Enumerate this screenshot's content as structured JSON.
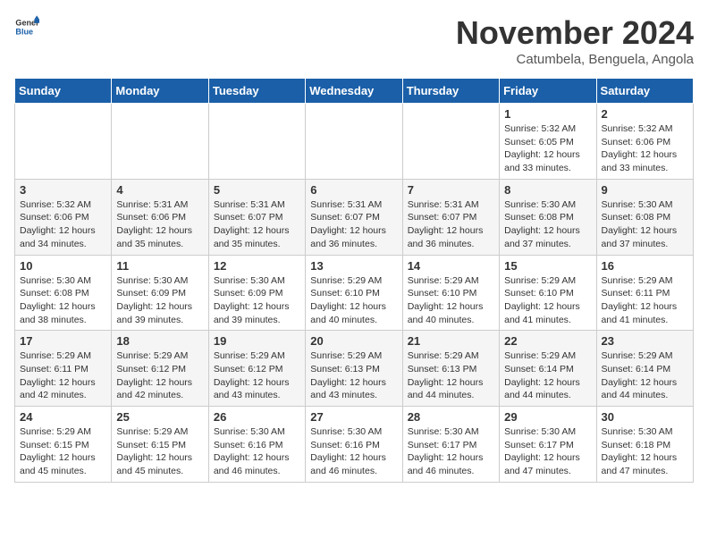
{
  "header": {
    "logo_general": "General",
    "logo_blue": "Blue",
    "month_title": "November 2024",
    "subtitle": "Catumbela, Benguela, Angola"
  },
  "weekdays": [
    "Sunday",
    "Monday",
    "Tuesday",
    "Wednesday",
    "Thursday",
    "Friday",
    "Saturday"
  ],
  "weeks": [
    [
      {
        "day": "",
        "info": ""
      },
      {
        "day": "",
        "info": ""
      },
      {
        "day": "",
        "info": ""
      },
      {
        "day": "",
        "info": ""
      },
      {
        "day": "",
        "info": ""
      },
      {
        "day": "1",
        "info": "Sunrise: 5:32 AM\nSunset: 6:05 PM\nDaylight: 12 hours\nand 33 minutes."
      },
      {
        "day": "2",
        "info": "Sunrise: 5:32 AM\nSunset: 6:06 PM\nDaylight: 12 hours\nand 33 minutes."
      }
    ],
    [
      {
        "day": "3",
        "info": "Sunrise: 5:32 AM\nSunset: 6:06 PM\nDaylight: 12 hours\nand 34 minutes."
      },
      {
        "day": "4",
        "info": "Sunrise: 5:31 AM\nSunset: 6:06 PM\nDaylight: 12 hours\nand 35 minutes."
      },
      {
        "day": "5",
        "info": "Sunrise: 5:31 AM\nSunset: 6:07 PM\nDaylight: 12 hours\nand 35 minutes."
      },
      {
        "day": "6",
        "info": "Sunrise: 5:31 AM\nSunset: 6:07 PM\nDaylight: 12 hours\nand 36 minutes."
      },
      {
        "day": "7",
        "info": "Sunrise: 5:31 AM\nSunset: 6:07 PM\nDaylight: 12 hours\nand 36 minutes."
      },
      {
        "day": "8",
        "info": "Sunrise: 5:30 AM\nSunset: 6:08 PM\nDaylight: 12 hours\nand 37 minutes."
      },
      {
        "day": "9",
        "info": "Sunrise: 5:30 AM\nSunset: 6:08 PM\nDaylight: 12 hours\nand 37 minutes."
      }
    ],
    [
      {
        "day": "10",
        "info": "Sunrise: 5:30 AM\nSunset: 6:08 PM\nDaylight: 12 hours\nand 38 minutes."
      },
      {
        "day": "11",
        "info": "Sunrise: 5:30 AM\nSunset: 6:09 PM\nDaylight: 12 hours\nand 39 minutes."
      },
      {
        "day": "12",
        "info": "Sunrise: 5:30 AM\nSunset: 6:09 PM\nDaylight: 12 hours\nand 39 minutes."
      },
      {
        "day": "13",
        "info": "Sunrise: 5:29 AM\nSunset: 6:10 PM\nDaylight: 12 hours\nand 40 minutes."
      },
      {
        "day": "14",
        "info": "Sunrise: 5:29 AM\nSunset: 6:10 PM\nDaylight: 12 hours\nand 40 minutes."
      },
      {
        "day": "15",
        "info": "Sunrise: 5:29 AM\nSunset: 6:10 PM\nDaylight: 12 hours\nand 41 minutes."
      },
      {
        "day": "16",
        "info": "Sunrise: 5:29 AM\nSunset: 6:11 PM\nDaylight: 12 hours\nand 41 minutes."
      }
    ],
    [
      {
        "day": "17",
        "info": "Sunrise: 5:29 AM\nSunset: 6:11 PM\nDaylight: 12 hours\nand 42 minutes."
      },
      {
        "day": "18",
        "info": "Sunrise: 5:29 AM\nSunset: 6:12 PM\nDaylight: 12 hours\nand 42 minutes."
      },
      {
        "day": "19",
        "info": "Sunrise: 5:29 AM\nSunset: 6:12 PM\nDaylight: 12 hours\nand 43 minutes."
      },
      {
        "day": "20",
        "info": "Sunrise: 5:29 AM\nSunset: 6:13 PM\nDaylight: 12 hours\nand 43 minutes."
      },
      {
        "day": "21",
        "info": "Sunrise: 5:29 AM\nSunset: 6:13 PM\nDaylight: 12 hours\nand 44 minutes."
      },
      {
        "day": "22",
        "info": "Sunrise: 5:29 AM\nSunset: 6:14 PM\nDaylight: 12 hours\nand 44 minutes."
      },
      {
        "day": "23",
        "info": "Sunrise: 5:29 AM\nSunset: 6:14 PM\nDaylight: 12 hours\nand 44 minutes."
      }
    ],
    [
      {
        "day": "24",
        "info": "Sunrise: 5:29 AM\nSunset: 6:15 PM\nDaylight: 12 hours\nand 45 minutes."
      },
      {
        "day": "25",
        "info": "Sunrise: 5:29 AM\nSunset: 6:15 PM\nDaylight: 12 hours\nand 45 minutes."
      },
      {
        "day": "26",
        "info": "Sunrise: 5:30 AM\nSunset: 6:16 PM\nDaylight: 12 hours\nand 46 minutes."
      },
      {
        "day": "27",
        "info": "Sunrise: 5:30 AM\nSunset: 6:16 PM\nDaylight: 12 hours\nand 46 minutes."
      },
      {
        "day": "28",
        "info": "Sunrise: 5:30 AM\nSunset: 6:17 PM\nDaylight: 12 hours\nand 46 minutes."
      },
      {
        "day": "29",
        "info": "Sunrise: 5:30 AM\nSunset: 6:17 PM\nDaylight: 12 hours\nand 47 minutes."
      },
      {
        "day": "30",
        "info": "Sunrise: 5:30 AM\nSunset: 6:18 PM\nDaylight: 12 hours\nand 47 minutes."
      }
    ]
  ]
}
